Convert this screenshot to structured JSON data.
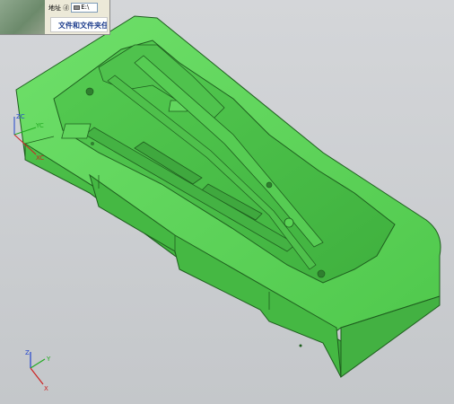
{
  "explorer": {
    "address_label": "地址 ⓓ",
    "address_value": "E:\\",
    "tasks_label": "文件和文件夹任务"
  },
  "datum_csys": {
    "zc": "ZC",
    "yc": "YC",
    "xc": "XC"
  },
  "triad": {
    "z": "Z",
    "y": "Y",
    "x": "X"
  },
  "colors": {
    "part_face": "#5fd35b",
    "part_dark": "#38a839",
    "part_edge": "#1e5e1e",
    "background": "#c8cacd",
    "axis_x": "#cc2222",
    "axis_y": "#22aa22",
    "axis_z": "#2244cc"
  },
  "icons": [
    "drive-icon"
  ]
}
